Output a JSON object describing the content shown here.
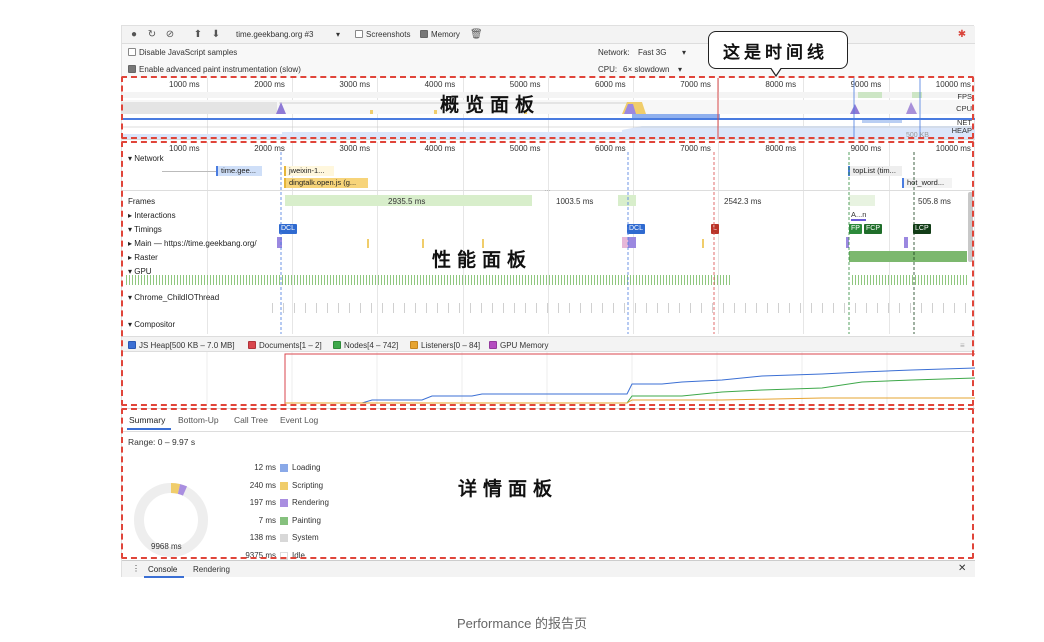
{
  "toolbar": {
    "profile_select": "time.geekbang.org #3",
    "screenshots_label": "Screenshots",
    "memory_label": "Memory"
  },
  "settings": {
    "disable_js_samples": "Disable JavaScript samples",
    "advanced_paint": "Enable advanced paint instrumentation (slow)",
    "network_label": "Network:",
    "network_value": "Fast 3G",
    "cpu_label": "CPU:",
    "cpu_value": "6× slowdown"
  },
  "ruler": {
    "overview_ticks": [
      "1000 ms",
      "2000 ms",
      "3000 ms",
      "4000 ms",
      "5000 ms",
      "6000 ms",
      "7000 ms",
      "8000 ms",
      "9000 ms",
      "10000 ms"
    ],
    "flame_ticks": [
      "1000 ms",
      "2000 ms",
      "3000 ms",
      "4000 ms",
      "5000 ms",
      "6000 ms",
      "7000 ms",
      "8000 ms",
      "9000 ms",
      "10000 ms"
    ]
  },
  "overview_tracks": [
    "FPS",
    "CPU",
    "NET",
    "HEAP"
  ],
  "overview_heap_value": "500 KB",
  "network": {
    "label": "Network",
    "requests": [
      "time.gee...",
      "jweixin-1...",
      "dingtalk.open.js (g...",
      "topList (tim...",
      "hot_word..."
    ]
  },
  "frames": {
    "label": "Frames",
    "durations": [
      "2935.5 ms",
      "1003.5 ms",
      "2542.3 ms",
      "505.8 ms"
    ]
  },
  "rows": {
    "interactions": "Interactions",
    "timings": "Timings",
    "main": "Main — https://time.geekbang.org/",
    "raster": "Raster",
    "gpu": "GPU",
    "child_io": "Chrome_ChildIOThread",
    "compositor": "Compositor"
  },
  "timing_markers": [
    "DCL",
    "DCL",
    "L",
    "FP",
    "FCP",
    "LCP"
  ],
  "interaction_label": "A...n",
  "memory_legend": [
    "JS Heap[500 KB – 7.0 MB]",
    "Documents[1 – 2]",
    "Nodes[4 – 742]",
    "Listeners[0 – 84]",
    "GPU Memory"
  ],
  "details": {
    "tabs": [
      "Summary",
      "Bottom-Up",
      "Call Tree",
      "Event Log"
    ],
    "range": "Range: 0 – 9.97 s",
    "total": "9968 ms",
    "items": [
      {
        "value": "12 ms",
        "label": "Loading",
        "color": "#8aa9e8"
      },
      {
        "value": "240 ms",
        "label": "Scripting",
        "color": "#f0cd6b"
      },
      {
        "value": "197 ms",
        "label": "Rendering",
        "color": "#a98ee0"
      },
      {
        "value": "7 ms",
        "label": "Painting",
        "color": "#86c17e"
      },
      {
        "value": "138 ms",
        "label": "System",
        "color": "#d8d8d8"
      },
      {
        "value": "9375 ms",
        "label": "Idle",
        "color": "#ffffff"
      }
    ]
  },
  "drawer": {
    "tabs": [
      "Console",
      "Rendering"
    ]
  },
  "annotations": {
    "overview": "概览面板",
    "performance": "性能面板",
    "details": "详情面板",
    "timeline": "这是时间线"
  },
  "caption": "Performance 的报告页",
  "colors": {
    "annotation_red": "#e0453a",
    "accent_blue": "#3b6fd4"
  }
}
